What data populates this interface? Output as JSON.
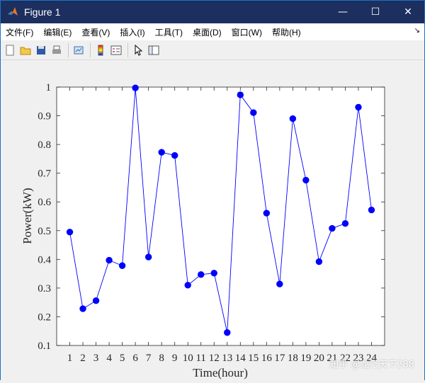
{
  "window": {
    "title": "Figure 1",
    "minimize_glyph": "—",
    "maximize_glyph": "☐",
    "close_glyph": "✕"
  },
  "menubar": {
    "items": [
      "文件(F)",
      "编辑(E)",
      "查看(V)",
      "插入(I)",
      "工具(T)",
      "桌面(D)",
      "窗口(W)",
      "帮助(H)"
    ],
    "extra_glyph": "↘"
  },
  "toolbar": {
    "icons": [
      "new-figure-icon",
      "open-file-icon",
      "save-icon",
      "print-icon",
      "link-plot-icon",
      "colorbar-icon",
      "legend-icon",
      "pointer-icon",
      "property-inspector-icon"
    ]
  },
  "watermark": "知乎 @龙行天下288",
  "chart_data": {
    "type": "line",
    "x": [
      1,
      2,
      3,
      4,
      5,
      6,
      7,
      8,
      9,
      10,
      11,
      12,
      13,
      14,
      15,
      16,
      17,
      18,
      19,
      20,
      21,
      22,
      23,
      24
    ],
    "series": [
      {
        "values": [
          0.495,
          0.228,
          0.256,
          0.397,
          0.378,
          0.997,
          0.408,
          0.773,
          0.762,
          0.31,
          0.347,
          0.352,
          0.145,
          0.973,
          0.911,
          0.561,
          0.314,
          0.89,
          0.676,
          0.392,
          0.508,
          0.525,
          0.93,
          0.572
        ],
        "color": "#0000ff",
        "marker": "circle"
      }
    ],
    "xlabel": "Time(hour)",
    "ylabel": "Power(kW)",
    "xlim": [
      0,
      25
    ],
    "ylim": [
      0.1,
      1.0
    ],
    "xticks": [
      1,
      2,
      3,
      4,
      5,
      6,
      7,
      8,
      9,
      10,
      11,
      12,
      13,
      14,
      15,
      16,
      17,
      18,
      19,
      20,
      21,
      22,
      23,
      24
    ],
    "yticks": [
      0.1,
      0.2,
      0.3,
      0.4,
      0.5,
      0.6,
      0.7,
      0.8,
      0.9,
      1
    ],
    "grid": false
  }
}
